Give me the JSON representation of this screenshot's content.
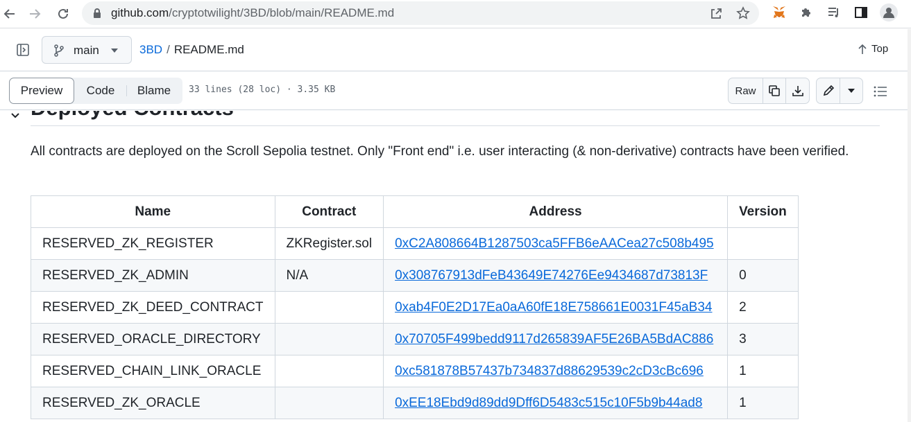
{
  "browser": {
    "url_host": "github.com",
    "url_path": "/cryptotwilight/3BD/blob/main/README.md"
  },
  "header": {
    "branch": "main",
    "repo": "3BD",
    "separator": "/",
    "file": "README.md",
    "top_label": "Top"
  },
  "toolbar": {
    "tabs": [
      "Preview",
      "Code",
      "Blame"
    ],
    "meta": "33 lines (28 loc) · 3.35 KB",
    "raw_label": "Raw"
  },
  "readme": {
    "heading": "Deployed Contracts",
    "paragraph": "All contracts are deployed on the Scroll Sepolia testnet. Only \"Front end\" i.e. user interacting (& non-derivative) contracts have been verified.",
    "table": {
      "headers": [
        "Name",
        "Contract",
        "Address",
        "Version"
      ],
      "rows": [
        {
          "name": "RESERVED_ZK_REGISTER",
          "contract": "ZKRegister.sol",
          "address": "0xC2A808664B1287503ca5FFB6eAACea27c508b495",
          "version": ""
        },
        {
          "name": "RESERVED_ZK_ADMIN",
          "contract": "N/A",
          "address": "0x308767913dFeB43649E74276Ee9434687d73813F",
          "version": "0"
        },
        {
          "name": "RESERVED_ZK_DEED_CONTRACT",
          "contract": "",
          "address": "0xab4F0E2D17Ea0aA60fE18E758661E0031F45aB34",
          "version": "2"
        },
        {
          "name": "RESERVED_ORACLE_DIRECTORY",
          "contract": "",
          "address": "0x70705F499bedd9117d265839AF5E26BA5BdAC886",
          "version": "3"
        },
        {
          "name": "RESERVED_CHAIN_LINK_ORACLE",
          "contract": "",
          "address": "0xc581878B57437b734837d88629539c2cD3cBc696",
          "version": "1"
        },
        {
          "name": "RESERVED_ZK_ORACLE",
          "contract": "",
          "address": "0xEE18Ebd9d89dd9Dff6D5483c515c10F5b9b44ad8",
          "version": "1"
        }
      ]
    }
  },
  "icons": {
    "back": "back-arrow-icon",
    "forward": "forward-arrow-icon",
    "reload": "reload-icon",
    "lock": "lock-icon",
    "share": "share-icon",
    "star": "star-icon",
    "metamask": "metamask-fox-icon",
    "extensions": "puzzle-icon",
    "media": "media-queue-icon",
    "sidepanel": "side-panel-icon",
    "profile": "profile-icon"
  },
  "colors": {
    "link": "#0969da",
    "border": "#d0d7de",
    "text": "#1f2328"
  }
}
